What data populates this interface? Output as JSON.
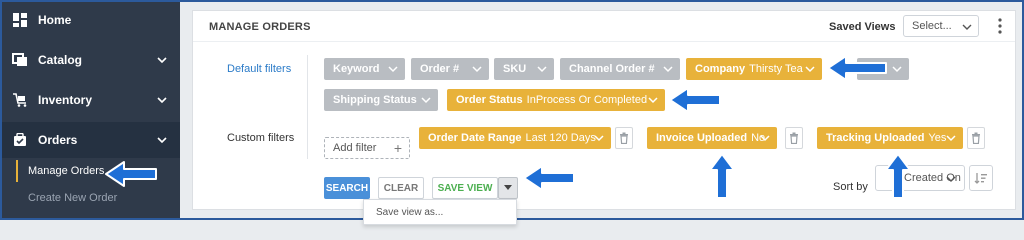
{
  "sidebar": {
    "items": [
      {
        "label": "Home",
        "icon": "home-icon"
      },
      {
        "label": "Catalog",
        "icon": "catalog-icon"
      },
      {
        "label": "Inventory",
        "icon": "inventory-icon"
      },
      {
        "label": "Orders",
        "icon": "orders-icon"
      }
    ],
    "sub_items": [
      {
        "label": "Manage Orders"
      },
      {
        "label": "Create New Order"
      }
    ]
  },
  "header": {
    "title": "MANAGE ORDERS",
    "saved_views_label": "Saved Views",
    "saved_views_value": "Select..."
  },
  "filters": {
    "default_label": "Default filters",
    "custom_label": "Custom filters",
    "default_chips": [
      {
        "label": "Keyword",
        "value": ""
      },
      {
        "label": "Order #",
        "value": ""
      },
      {
        "label": "SKU",
        "value": ""
      },
      {
        "label": "Channel Order #",
        "value": ""
      },
      {
        "label": "Company",
        "value": "Thirsty Tea"
      },
      {
        "label": "d",
        "value": ""
      },
      {
        "label": "Shipping Status",
        "value": ""
      },
      {
        "label": "Order Status",
        "value": "InProcess Or Completed"
      }
    ],
    "add_filter_label": "Add filter",
    "custom_chips": [
      {
        "label": "Order Date Range",
        "value": "Last 120 Days"
      },
      {
        "label": "Invoice Uploaded",
        "value": "No"
      },
      {
        "label": "Tracking Uploaded",
        "value": "Yes"
      }
    ]
  },
  "actions": {
    "search": "SEARCH",
    "clear": "CLEAR",
    "save_view": "SAVE VIEW",
    "save_view_as": "Save view as..."
  },
  "sort": {
    "label": "Sort by",
    "value": "Created On"
  },
  "colors": {
    "sidebar_bg": "#2f3a4a",
    "chip_active": "#e8b23a",
    "chip_inactive": "#b9bdc2",
    "link_blue": "#2b7bc8",
    "arrow_blue": "#1f6fd6",
    "search_button": "#4a90d9",
    "save_green": "#4caf50"
  }
}
